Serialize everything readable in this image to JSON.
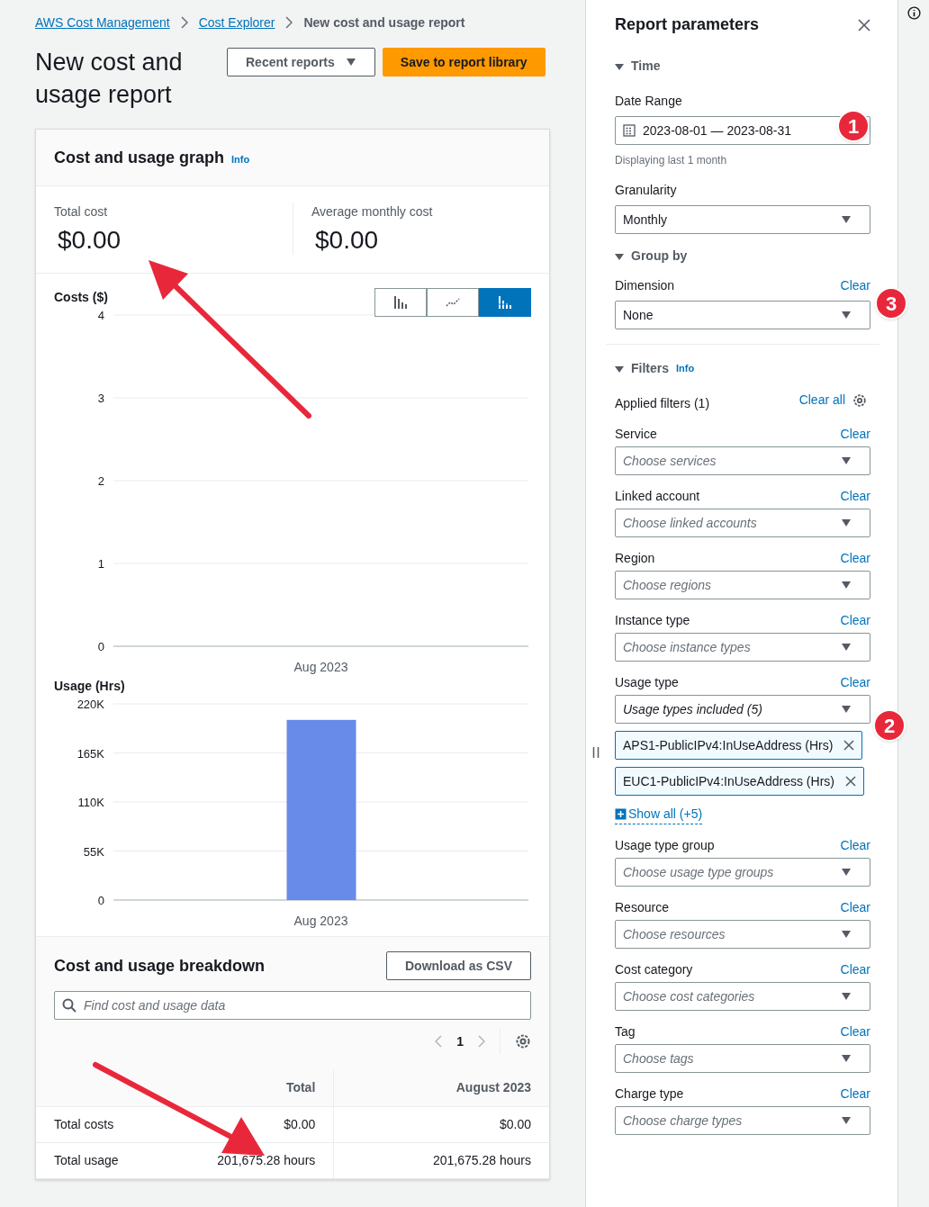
{
  "breadcrumbs": [
    {
      "label": "AWS Cost Management",
      "link": true
    },
    {
      "label": "Cost Explorer",
      "link": true
    },
    {
      "label": "New cost and usage report",
      "link": false
    }
  ],
  "page_title": "New cost and usage report",
  "header_buttons": [
    {
      "label": "Recent reports",
      "kind": "dropdown"
    },
    {
      "label": "Save to report library",
      "kind": "primary"
    }
  ],
  "graph_panel": {
    "title": "Cost and usage graph",
    "info": "Info",
    "summary": [
      {
        "label": "Total cost",
        "value": "$0.00"
      },
      {
        "label": "Average monthly cost",
        "value": "$0.00"
      }
    ],
    "chart_types": [
      {
        "kind": "bar",
        "selected": false
      },
      {
        "kind": "line",
        "selected": false
      },
      {
        "kind": "stacked",
        "selected": true
      }
    ],
    "charts": [
      {
        "title": "Costs ($)",
        "chart_data": {
          "type": "bar",
          "grid": true,
          "categories": [
            "Aug 2023"
          ],
          "ylim": [
            0,
            4
          ],
          "yticks": [
            0,
            1,
            2,
            3,
            4
          ]
        }
      },
      {
        "title": "Usage (Hrs)",
        "chart_data": {
          "type": "bar",
          "grid": true,
          "categories": [
            "Aug 2023"
          ],
          "values": [
            202000
          ],
          "ylim": [
            0,
            220000
          ],
          "yticks": [
            {
              "value": 0,
              "label": "0"
            },
            {
              "value": 55000,
              "label": "55K"
            },
            {
              "value": 110000,
              "label": "110K"
            },
            {
              "value": 165000,
              "label": "165K"
            },
            {
              "value": 220000,
              "label": "220K"
            }
          ]
        }
      }
    ]
  },
  "breakdown": {
    "title": "Cost and usage breakdown",
    "download": "Download as CSV",
    "search": {
      "placeholder": "Find cost and usage data"
    },
    "page": "1",
    "columns": [
      "Total",
      "August 2023"
    ],
    "rows": [
      {
        "label": "Total costs",
        "values": [
          "$0.00",
          "$0.00"
        ]
      },
      {
        "label": "Total usage",
        "values": [
          "201,675.28 hours",
          "201,675.28 hours"
        ]
      }
    ]
  },
  "report_parameters": {
    "title": "Report parameters",
    "time": {
      "title": "Time",
      "expanded": true,
      "date_range_label": "Date Range",
      "date_range": "2023-08-01 — 2023-08-31",
      "hint": "Displaying last 1 month",
      "granularity_label": "Granularity",
      "granularity": "Monthly"
    },
    "group_by": {
      "title": "Group by",
      "expanded": true,
      "dimension_label": "Dimension",
      "clear": "Clear",
      "dimension": "None"
    },
    "filters": {
      "title": "Filters",
      "expanded": true,
      "info": "Info",
      "applied": "Applied filters (1)",
      "clear_all": "Clear all",
      "items": [
        {
          "label": "Service",
          "clear": "Clear",
          "placeholder": "Choose services"
        },
        {
          "label": "Linked account",
          "clear": "Clear",
          "placeholder": "Choose linked accounts"
        },
        {
          "label": "Region",
          "clear": "Clear",
          "placeholder": "Choose regions"
        },
        {
          "label": "Instance type",
          "clear": "Clear",
          "placeholder": "Choose instance types"
        },
        {
          "label": "Usage type",
          "clear": "Clear",
          "summary": "Usage types included (5)",
          "tokens": [
            "APS1-PublicIPv4:InUseAddress (Hrs)",
            "EUC1-PublicIPv4:InUseAddress (Hrs)"
          ],
          "show_all": "Show all (+5)"
        },
        {
          "label": "Usage type group",
          "clear": "Clear",
          "placeholder": "Choose usage type groups"
        },
        {
          "label": "Resource",
          "clear": "Clear",
          "placeholder": "Choose resources"
        },
        {
          "label": "Cost category",
          "clear": "Clear",
          "placeholder": "Choose cost categories"
        },
        {
          "label": "Tag",
          "clear": "Clear",
          "placeholder": "Choose tags"
        },
        {
          "label": "Charge type",
          "clear": "Clear",
          "placeholder": "Choose charge types"
        }
      ]
    }
  },
  "annotations": [
    "1",
    "3",
    "2"
  ]
}
